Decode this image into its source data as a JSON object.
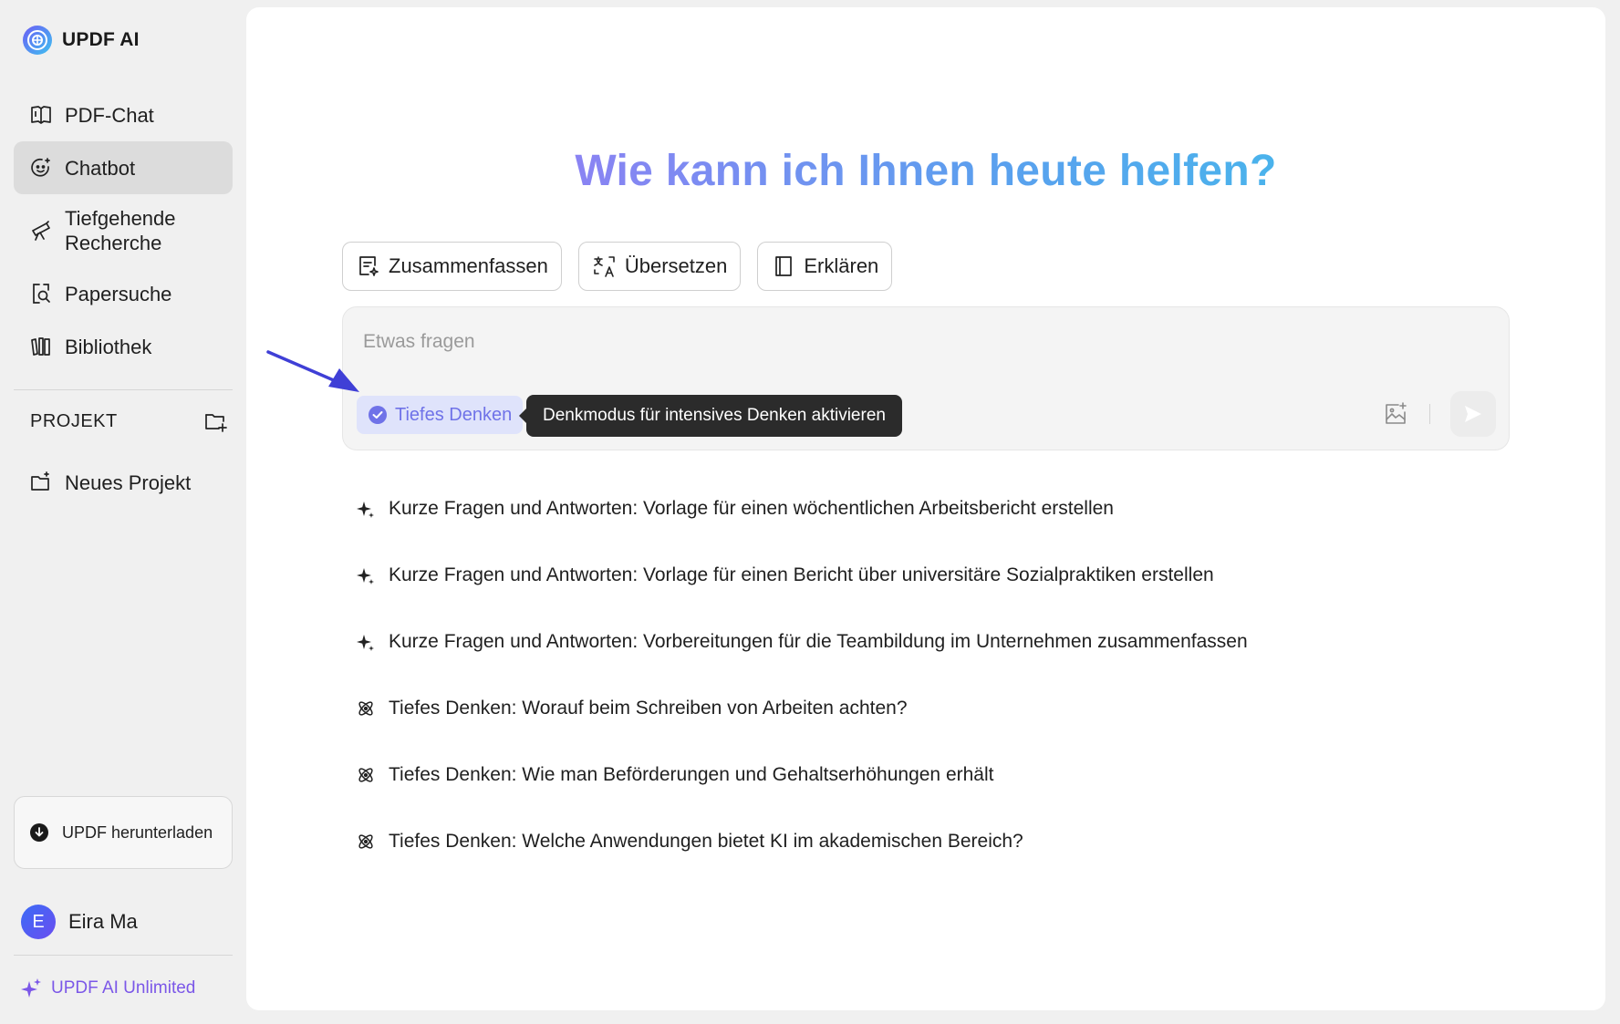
{
  "brand": {
    "name": "UPDF AI"
  },
  "sidebar": {
    "items": [
      {
        "label": "PDF-Chat",
        "icon": "book-open-icon",
        "active": false
      },
      {
        "label": "Chatbot",
        "icon": "chatbot-face-icon",
        "active": true
      },
      {
        "label": "Tiefgehende Recherche",
        "icon": "telescope-icon",
        "active": false
      },
      {
        "label": "Papersuche",
        "icon": "document-search-icon",
        "active": false
      },
      {
        "label": "Bibliothek",
        "icon": "library-icon",
        "active": false
      }
    ],
    "project_title": "PROJEKT",
    "new_project_label": "Neues Projekt",
    "download_label": "UPDF herunterladen",
    "user": {
      "initial": "E",
      "name": "Eira Ma"
    },
    "unlimited_label": "UPDF AI Unlimited"
  },
  "main": {
    "headline": "Wie kann ich Ihnen heute helfen?",
    "quick_actions": [
      {
        "label": "Zusammenfassen",
        "icon": "summarize-icon"
      },
      {
        "label": "Übersetzen",
        "icon": "translate-icon"
      },
      {
        "label": "Erklären",
        "icon": "explain-book-icon"
      }
    ],
    "composer": {
      "placeholder": "Etwas fragen",
      "value": "",
      "deep_thinking_label": "Tiefes Denken",
      "tooltip": "Denkmodus für intensives Denken aktivieren"
    },
    "suggestions": [
      {
        "text": "Kurze Fragen und Antworten: Vorlage für einen wöchentlichen Arbeitsbericht erstellen",
        "icon": "sparkle-icon"
      },
      {
        "text": "Kurze Fragen und Antworten: Vorlage für einen Bericht über universitäre Sozialpraktiken erstellen",
        "icon": "sparkle-icon"
      },
      {
        "text": "Kurze Fragen und Antworten: Vorbereitungen für die Teambildung im Unternehmen zusammenfassen",
        "icon": "sparkle-icon"
      },
      {
        "text": "Tiefes Denken: Worauf beim Schreiben von Arbeiten achten?",
        "icon": "atom-icon"
      },
      {
        "text": "Tiefes Denken: Wie man Beförderungen und Gehaltserhöhungen erhält",
        "icon": "atom-icon"
      },
      {
        "text": "Tiefes Denken: Welche Anwendungen bietet KI im akademischen Bereich?",
        "icon": "atom-icon"
      }
    ]
  },
  "colors": {
    "accent": "#6f72e8",
    "unlimited": "#7b57e8",
    "annotation_arrow": "#3f3fd6",
    "tooltip_bg": "#2b2b2b"
  }
}
